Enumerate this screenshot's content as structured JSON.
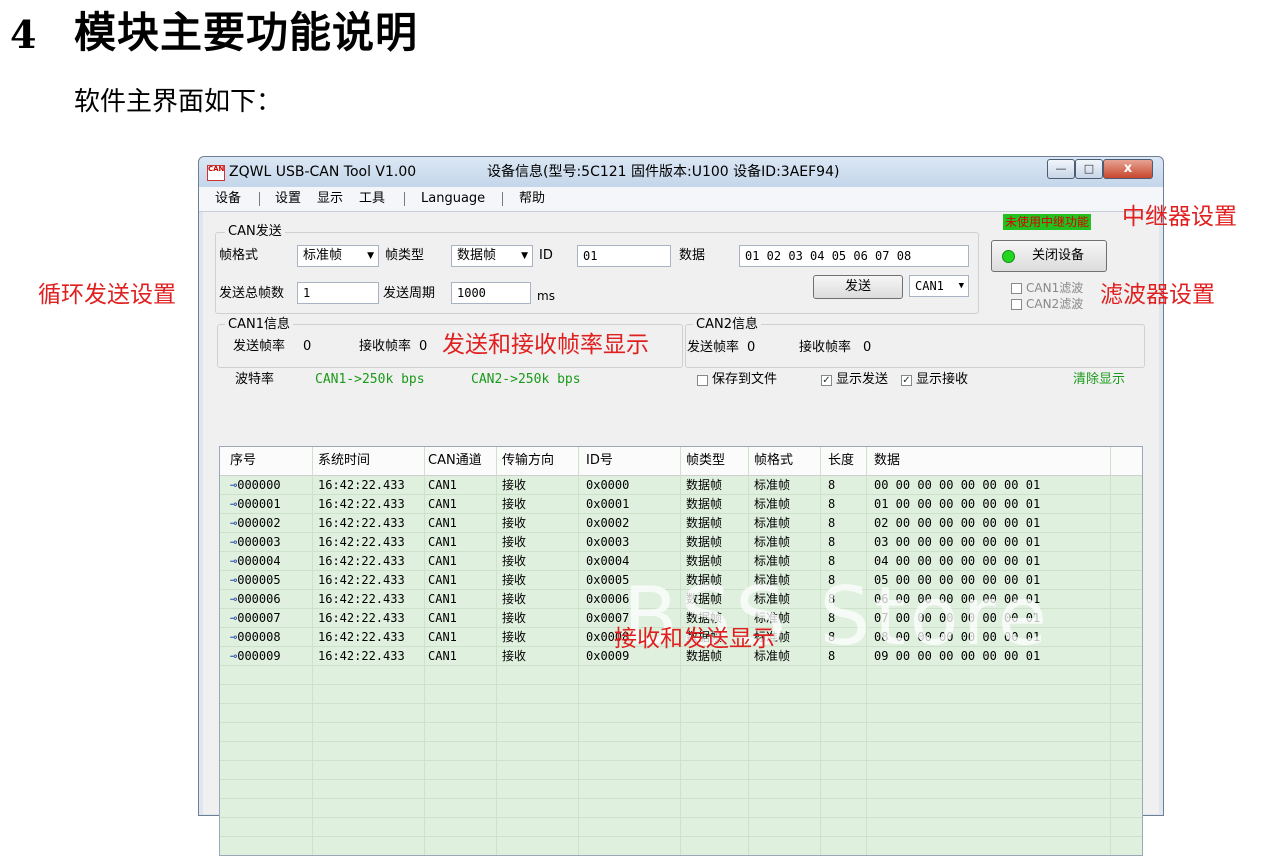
{
  "doc": {
    "section_number": "4",
    "section_title": "模块主要功能说明",
    "intro": "软件主界面如下："
  },
  "annotations": {
    "relay": "中继器设置",
    "loop_send": "循环发送设置",
    "filter": "滤波器设置",
    "rate": "发送和接收帧率显示",
    "display": "接收和发送显示"
  },
  "window": {
    "app_icon_text": "CAN",
    "title": "ZQWL USB-CAN Tool V1.00",
    "device_info": "设备信息(型号:5C121   固件版本:U100   设备ID:3AEF94)",
    "controls": {
      "minimize": "—",
      "maximize": "□",
      "close": "x"
    }
  },
  "menu": [
    "设备",
    "设置",
    "显示",
    "工具",
    "Language",
    "帮助"
  ],
  "can_send": {
    "group_title": "CAN发送",
    "frame_format_label": "帧格式",
    "frame_format_value": "标准帧",
    "frame_type_label": "帧类型",
    "frame_type_value": "数据帧",
    "id_label": "ID",
    "id_value": "01",
    "data_label": "数据",
    "data_value": "01 02 03 04 05 06 07 08",
    "total_frames_label": "发送总帧数",
    "total_frames_value": "1",
    "period_label": "发送周期",
    "period_value": "1000",
    "period_unit": "ms",
    "send_button": "发送",
    "channel_value": "CAN1"
  },
  "right_panel": {
    "relay_status": "未使用中继功能",
    "close_device_button": "关闭设备",
    "can1_filter": "CAN1滤波",
    "can2_filter": "CAN2滤波"
  },
  "can1_info": {
    "title": "CAN1信息",
    "send_rate_label": "发送帧率",
    "send_rate_value": "0",
    "recv_rate_label": "接收帧率",
    "recv_rate_value": "0"
  },
  "can2_info": {
    "title": "CAN2信息",
    "send_rate_label": "发送帧率",
    "send_rate_value": "0",
    "recv_rate_label": "接收帧率",
    "recv_rate_value": "0"
  },
  "baud": {
    "label": "波特率",
    "can1": "CAN1->250k  bps",
    "can2": "CAN2->250k  bps"
  },
  "options": {
    "save_to_file": "保存到文件",
    "save_to_file_checked": false,
    "show_send": "显示发送",
    "show_send_checked": true,
    "show_recv": "显示接收",
    "show_recv_checked": true,
    "clear_display": "清除显示"
  },
  "table": {
    "headers": [
      "序号",
      "系统时间",
      "CAN通道",
      "传输方向",
      "ID号",
      "帧类型",
      "帧格式",
      "长度",
      "数据"
    ],
    "rows": [
      [
        "000000",
        "16:42:22.433",
        "CAN1",
        "接收",
        "0x0000",
        "数据帧",
        "标准帧",
        "8",
        "00 00 00 00 00 00 00 01"
      ],
      [
        "000001",
        "16:42:22.433",
        "CAN1",
        "接收",
        "0x0001",
        "数据帧",
        "标准帧",
        "8",
        "01 00 00 00 00 00 00 01"
      ],
      [
        "000002",
        "16:42:22.433",
        "CAN1",
        "接收",
        "0x0002",
        "数据帧",
        "标准帧",
        "8",
        "02 00 00 00 00 00 00 01"
      ],
      [
        "000003",
        "16:42:22.433",
        "CAN1",
        "接收",
        "0x0003",
        "数据帧",
        "标准帧",
        "8",
        "03 00 00 00 00 00 00 01"
      ],
      [
        "000004",
        "16:42:22.433",
        "CAN1",
        "接收",
        "0x0004",
        "数据帧",
        "标准帧",
        "8",
        "04 00 00 00 00 00 00 01"
      ],
      [
        "000005",
        "16:42:22.433",
        "CAN1",
        "接收",
        "0x0005",
        "数据帧",
        "标准帧",
        "8",
        "05 00 00 00 00 00 00 01"
      ],
      [
        "000006",
        "16:42:22.433",
        "CAN1",
        "接收",
        "0x0006",
        "数据帧",
        "标准帧",
        "8",
        "06 00 00 00 00 00 00 01"
      ],
      [
        "000007",
        "16:42:22.433",
        "CAN1",
        "接收",
        "0x0007",
        "数据帧",
        "标准帧",
        "8",
        "07 00 00 00 00 00 00 01"
      ],
      [
        "000008",
        "16:42:22.433",
        "CAN1",
        "接收",
        "0x0008",
        "数据帧",
        "标准帧",
        "8",
        "08 00 00 00 00 00 00 01"
      ],
      [
        "000009",
        "16:42:22.433",
        "CAN1",
        "接收",
        "0x0009",
        "数据帧",
        "标准帧",
        "8",
        "09 00 00 00 00 00 00 01"
      ]
    ]
  },
  "watermark": "BSS Store",
  "colors": {
    "annotation": "#e02020",
    "table_bg": "#e0f0de",
    "relay_badge_bg": "#21c21f",
    "led": "#22d622"
  }
}
